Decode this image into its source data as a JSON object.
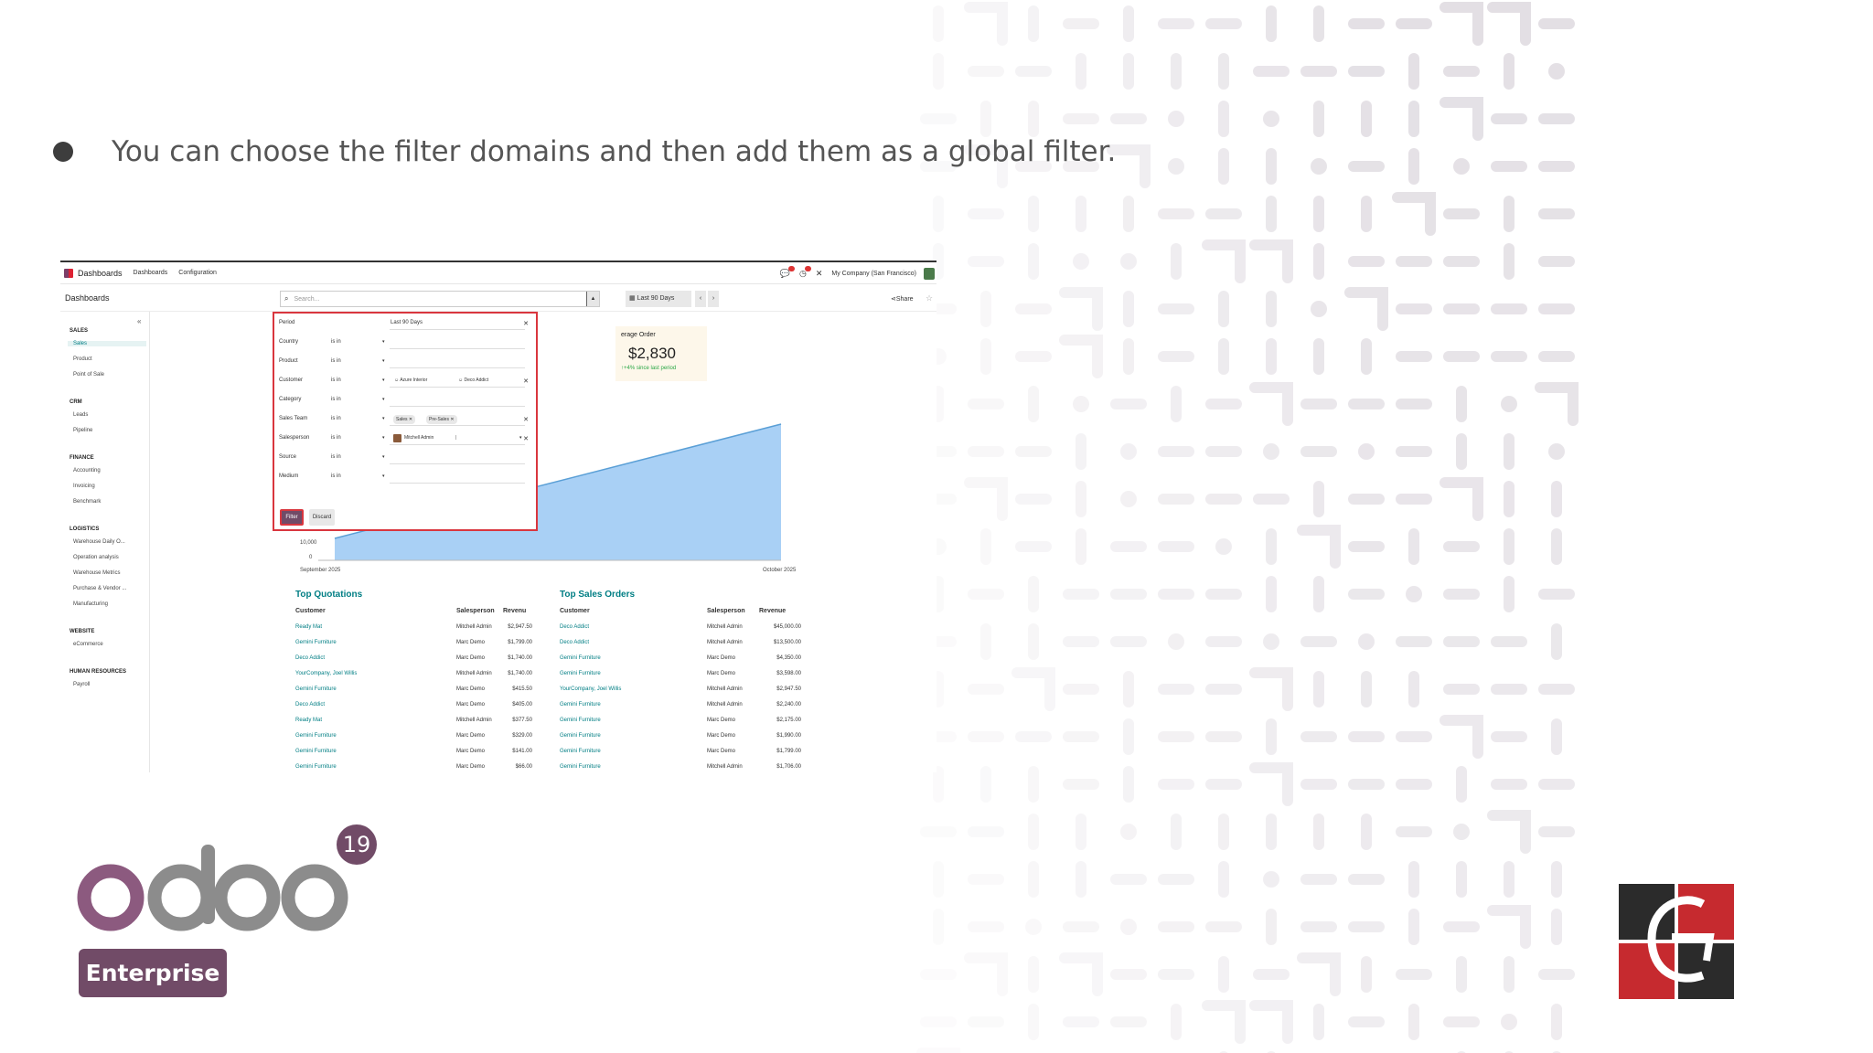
{
  "slide": {
    "bullet": "You can choose the filter domains and then add them as a global filter.",
    "brand": {
      "version": "19",
      "edition": "Enterprise"
    },
    "accent": "#714b67",
    "highlight": "#d9363e"
  },
  "app": {
    "brand": "Dashboards",
    "menu": [
      "Dashboards",
      "Configuration"
    ],
    "company": "My Company (San Francisco)",
    "breadcrumb": "Dashboards",
    "search_placeholder": "Search...",
    "period_label": "Last 90 Days",
    "share_label": "Share"
  },
  "sidebar": [
    {
      "section": "SALES",
      "items": [
        "Sales",
        "Product",
        "Point of Sale"
      ],
      "active": "Sales"
    },
    {
      "section": "CRM",
      "items": [
        "Leads",
        "Pipeline"
      ]
    },
    {
      "section": "FINANCE",
      "items": [
        "Accounting",
        "Invoicing",
        "Benchmark"
      ]
    },
    {
      "section": "LOGISTICS",
      "items": [
        "Warehouse Daily O...",
        "Operation analysis",
        "Warehouse Metrics",
        "Purchase & Vendor ...",
        "Manufacturing"
      ]
    },
    {
      "section": "WEBSITE",
      "items": [
        "eCommerce"
      ]
    },
    {
      "section": "HUMAN RESOURCES",
      "items": [
        "Payroll"
      ]
    }
  ],
  "kpi": {
    "title": "erage Order",
    "value": "$2,830",
    "delta": "+4% since last period"
  },
  "filter_popup": {
    "rows": [
      {
        "label": "Period",
        "operator": "",
        "value": "Last 90 Days",
        "clear": true
      },
      {
        "label": "Country",
        "operator": "is in",
        "value": ""
      },
      {
        "label": "Product",
        "operator": "is in",
        "value": ""
      },
      {
        "label": "Customer",
        "operator": "is in",
        "chips": [
          "Azure Interior",
          "Deco Addict"
        ],
        "clear": true
      },
      {
        "label": "Category",
        "operator": "is in",
        "value": ""
      },
      {
        "label": "Sales Team",
        "operator": "is in",
        "tags": [
          "Sales",
          "Pre-Sales"
        ],
        "clear": true
      },
      {
        "label": "Salesperson",
        "operator": "is in",
        "person": "Mitchell Admin",
        "clear": true
      },
      {
        "label": "Source",
        "operator": "is in",
        "value": ""
      },
      {
        "label": "Medium",
        "operator": "is in",
        "value": ""
      }
    ],
    "filter_btn": "Filter",
    "discard_btn": "Discard"
  },
  "chart_data": {
    "type": "area",
    "x": [
      "September 2025",
      "October 2025"
    ],
    "y_ticks": [
      "10,000",
      "0"
    ],
    "color": "#a9d0f5"
  },
  "top_quotations": {
    "title": "Top Quotations",
    "headers": [
      "Customer",
      "Salesperson",
      "Revenu"
    ],
    "rows": [
      [
        "Ready Mat",
        "Mitchell Admin",
        "$2,947.50"
      ],
      [
        "Gemini Furniture",
        "Marc Demo",
        "$1,799.00"
      ],
      [
        "Deco Addict",
        "Marc Demo",
        "$1,740.00"
      ],
      [
        "YourCompany, Joel Willis",
        "Mitchell Admin",
        "$1,740.00"
      ],
      [
        "Gemini Furniture",
        "Marc Demo",
        "$415.50"
      ],
      [
        "Deco Addict",
        "Marc Demo",
        "$405.00"
      ],
      [
        "Ready Mat",
        "Mitchell Admin",
        "$377.50"
      ],
      [
        "Gemini Furniture",
        "Marc Demo",
        "$329.00"
      ],
      [
        "Gemini Furniture",
        "Marc Demo",
        "$141.00"
      ],
      [
        "Gemini Furniture",
        "Marc Demo",
        "$66.00"
      ]
    ]
  },
  "top_sales_orders": {
    "title": "Top Sales Orders",
    "headers": [
      "Customer",
      "Salesperson",
      "Revenue"
    ],
    "rows": [
      [
        "Deco Addict",
        "Mitchell Admin",
        "$45,000.00"
      ],
      [
        "Deco Addict",
        "Mitchell Admin",
        "$13,500.00"
      ],
      [
        "Gemini Furniture",
        "Marc Demo",
        "$4,350.00"
      ],
      [
        "Gemini Furniture",
        "Marc Demo",
        "$3,598.00"
      ],
      [
        "YourCompany, Joel Willis",
        "Mitchell Admin",
        "$2,947.50"
      ],
      [
        "Gemini Furniture",
        "Mitchell Admin",
        "$2,240.00"
      ],
      [
        "Gemini Furniture",
        "Marc Demo",
        "$2,175.00"
      ],
      [
        "Gemini Furniture",
        "Marc Demo",
        "$1,990.00"
      ],
      [
        "Gemini Furniture",
        "Marc Demo",
        "$1,799.00"
      ],
      [
        "Gemini Furniture",
        "Mitchell Admin",
        "$1,706.00"
      ]
    ]
  }
}
